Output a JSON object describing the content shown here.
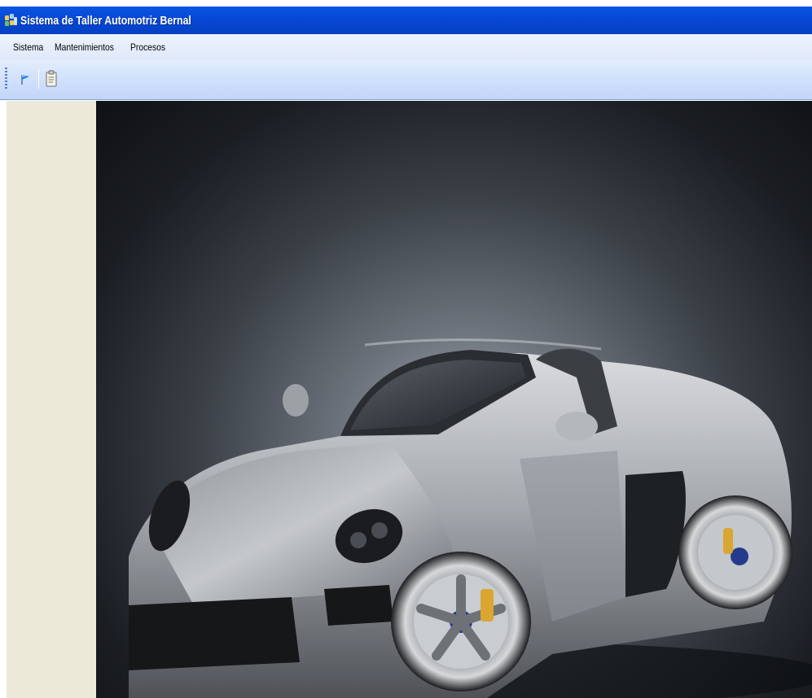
{
  "window": {
    "title": "Sistema de Taller Automotriz Bernal",
    "titlebar_color": "#0648d4"
  },
  "menubar": {
    "items": [
      {
        "label": "Sistema"
      },
      {
        "label": "Mantenimientos"
      },
      {
        "label": "Procesos"
      }
    ]
  },
  "toolbar": {
    "buttons": [
      {
        "icon": "flag-icon"
      },
      {
        "icon": "clipboard-icon"
      }
    ]
  },
  "main": {
    "background_image": "silver-sports-car-photo",
    "left_panel_color": "#ece9d8"
  }
}
